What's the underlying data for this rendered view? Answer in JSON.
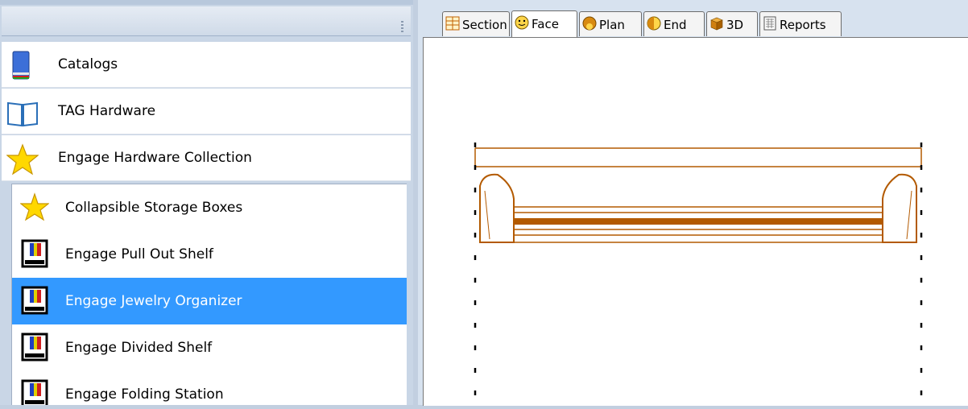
{
  "catalog_panel": {
    "categories": [
      {
        "label": "Catalogs",
        "icon": "book-blue-icon"
      },
      {
        "label": "TAG Hardware",
        "icon": "open-book-icon"
      },
      {
        "label": "Engage Hardware Collection",
        "icon": "star-icon"
      }
    ],
    "items": [
      {
        "label": "Collapsible Storage Boxes",
        "icon": "star-icon",
        "selected": false
      },
      {
        "label": "Engage Pull Out Shelf",
        "icon": "catalog-item-icon",
        "selected": false
      },
      {
        "label": "Engage Jewelry Organizer",
        "icon": "catalog-item-icon",
        "selected": true
      },
      {
        "label": "Engage Divided Shelf",
        "icon": "catalog-item-icon",
        "selected": false
      },
      {
        "label": "Engage Folding Station",
        "icon": "catalog-item-icon",
        "selected": false
      }
    ]
  },
  "view_tabs": [
    {
      "label": "Section",
      "icon": "section-icon"
    },
    {
      "label": "Face",
      "icon": "face-icon",
      "active": true
    },
    {
      "label": "Plan",
      "icon": "plan-icon"
    },
    {
      "label": "End",
      "icon": "end-icon"
    },
    {
      "label": "3D",
      "icon": "3d-box-icon"
    },
    {
      "label": "Reports",
      "icon": "reports-icon"
    }
  ],
  "colors": {
    "selection": "#3399ff",
    "drawing_wood": "#b35a00"
  }
}
